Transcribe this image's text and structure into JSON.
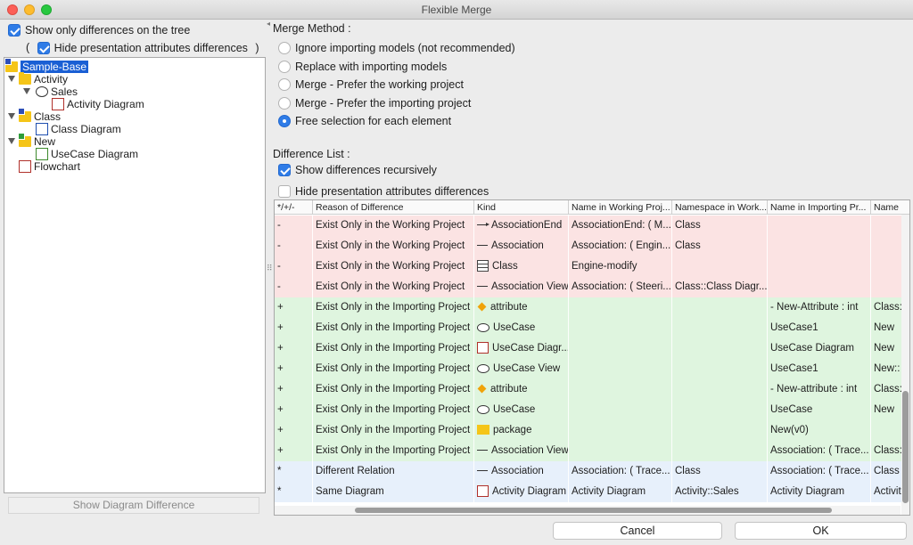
{
  "window": {
    "title": "Flexible Merge"
  },
  "left": {
    "show_only_diff": {
      "label": "Show only differences on the tree",
      "checked": true
    },
    "hide_presentation": {
      "prefix": "(",
      "label": "Hide presentation attributes differences",
      "suffix": ")",
      "checked": true
    },
    "tree": [
      {
        "label": "Sample-Base",
        "icon": "project-icon",
        "selected": true
      },
      {
        "label": "Activity",
        "icon": "folder-icon"
      },
      {
        "label": "Sales",
        "icon": "ellipse-icon"
      },
      {
        "label": "Activity Diagram",
        "icon": "activity-diagram-icon"
      },
      {
        "label": "Class",
        "icon": "package-icon"
      },
      {
        "label": "Class Diagram",
        "icon": "class-diagram-icon"
      },
      {
        "label": "New",
        "icon": "new-package-icon"
      },
      {
        "label": "UseCase Diagram",
        "icon": "usecase-diagram-icon"
      },
      {
        "label": "Flowchart",
        "icon": "flowchart-icon"
      }
    ],
    "show_diagram_button": "Show Diagram Difference"
  },
  "merge": {
    "label": "Merge Method :",
    "options": [
      {
        "label": "Ignore importing models (not recommended)",
        "selected": false
      },
      {
        "label": "Replace with importing models",
        "selected": false
      },
      {
        "label": "Merge - Prefer the working project",
        "selected": false
      },
      {
        "label": "Merge - Prefer the importing project",
        "selected": false
      },
      {
        "label": "Free selection for each element",
        "selected": true
      }
    ]
  },
  "difflist": {
    "label": "Difference List :",
    "recursive": {
      "label": "Show differences recursively",
      "checked": true
    },
    "hide_presentation": {
      "label": "Hide presentation attributes differences",
      "checked": false
    },
    "columns": [
      "*/+/-",
      "Reason of Difference",
      "Kind",
      "Name in Working Proj...",
      "Namespace in Work...",
      "Name in Importing Pr...",
      "Name"
    ],
    "rows": [
      {
        "sym": "-",
        "reason": "Exist Only in the Working Project",
        "kind": "AssociationEnd",
        "kind_icon": "arrow-line-icon",
        "wname": "AssociationEnd: ( M...",
        "wns": "Class",
        "iname": "",
        "ins": "",
        "status": "red"
      },
      {
        "sym": "-",
        "reason": "Exist Only in the Working Project",
        "kind": "Association",
        "kind_icon": "line-icon",
        "wname": "Association: ( Engin...",
        "wns": "Class",
        "iname": "",
        "ins": "",
        "status": "red"
      },
      {
        "sym": "-",
        "reason": "Exist Only in the Working Project",
        "kind": "Class",
        "kind_icon": "class-icon",
        "wname": "Engine-modify",
        "wns": "",
        "iname": "",
        "ins": "",
        "status": "red"
      },
      {
        "sym": "-",
        "reason": "Exist Only in the Working Project",
        "kind": "Association View",
        "kind_icon": "line-icon",
        "wname": "Association: ( Steeri...",
        "wns": "Class::Class Diagr...",
        "iname": "",
        "ins": "",
        "status": "red"
      },
      {
        "sym": "+",
        "reason": "Exist Only in the Importing Project",
        "kind": "attribute",
        "kind_icon": "diamond-icon",
        "wname": "",
        "wns": "",
        "iname": "- New-Attribute : int",
        "ins": "Class:",
        "status": "green"
      },
      {
        "sym": "+",
        "reason": "Exist Only in the Importing Project",
        "kind": "UseCase",
        "kind_icon": "ellipse-icon",
        "wname": "",
        "wns": "",
        "iname": "UseCase1",
        "ins": "New",
        "status": "green"
      },
      {
        "sym": "+",
        "reason": "Exist Only in the Importing Project",
        "kind": "UseCase Diagr...",
        "kind_icon": "diagram-icon",
        "wname": "",
        "wns": "",
        "iname": "UseCase Diagram",
        "ins": "New",
        "status": "green"
      },
      {
        "sym": "+",
        "reason": "Exist Only in the Importing Project",
        "kind": "UseCase View",
        "kind_icon": "ellipse-icon",
        "wname": "",
        "wns": "",
        "iname": "UseCase1",
        "ins": "New::",
        "status": "green"
      },
      {
        "sym": "+",
        "reason": "Exist Only in the Importing Project",
        "kind": "attribute",
        "kind_icon": "diamond-icon",
        "wname": "",
        "wns": "",
        "iname": "- New-attribute : int",
        "ins": "Class:",
        "status": "green"
      },
      {
        "sym": "+",
        "reason": "Exist Only in the Importing Project",
        "kind": "UseCase",
        "kind_icon": "ellipse-icon",
        "wname": "",
        "wns": "",
        "iname": "UseCase",
        "ins": "New",
        "status": "green"
      },
      {
        "sym": "+",
        "reason": "Exist Only in the Importing Project",
        "kind": "package",
        "kind_icon": "folder-icon",
        "wname": "",
        "wns": "",
        "iname": "New(v0)",
        "ins": "",
        "status": "green"
      },
      {
        "sym": "+",
        "reason": "Exist Only in the Importing Project",
        "kind": "Association View",
        "kind_icon": "line-icon",
        "wname": "",
        "wns": "",
        "iname": "Association: ( Trace...",
        "ins": "Class:",
        "status": "green"
      },
      {
        "sym": "*",
        "reason": "Different Relation",
        "kind": "Association",
        "kind_icon": "line-icon",
        "wname": "Association: ( Trace...",
        "wns": "Class",
        "iname": "Association: ( Trace...",
        "ins": "Class",
        "status": "blue"
      },
      {
        "sym": "*",
        "reason": "Same Diagram",
        "kind": "Activity Diagram",
        "kind_icon": "diagram-icon",
        "wname": "Activity Diagram",
        "wns": "Activity::Sales",
        "iname": "Activity Diagram",
        "ins": "Activit",
        "status": "blue"
      }
    ]
  },
  "buttons": {
    "cancel": "Cancel",
    "ok": "OK"
  },
  "colors": {
    "accent": "#2f7ce7",
    "selection": "#1a5fd4",
    "row_removed": "#fbe3e3",
    "row_added": "#dff5df",
    "row_changed": "#e7f0fb"
  }
}
